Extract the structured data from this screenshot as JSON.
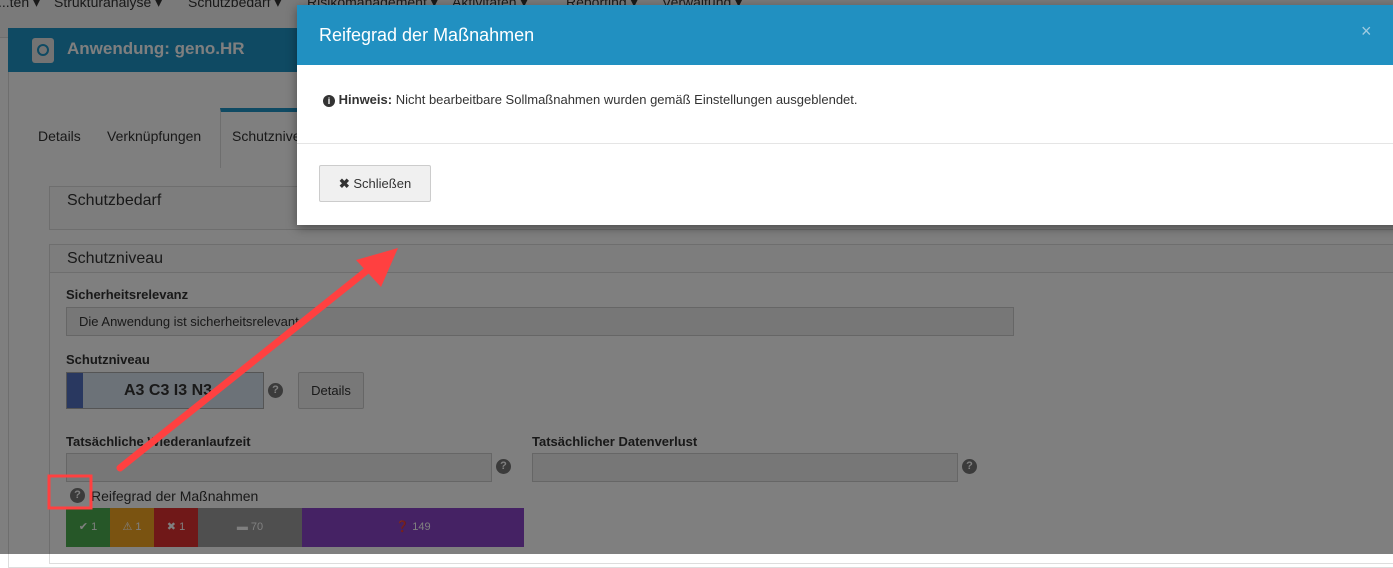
{
  "topnav": {
    "items": [
      "...ten ▾",
      "Strukturanalyse ▾",
      "Schutzbedarf ▾",
      "Risikomanagement ▾",
      "Aktivitäten ▾",
      "Reporting ▾",
      "Verwaltung ▾"
    ]
  },
  "card": {
    "title": "Anwendung: geno.HR",
    "tabs": [
      "Details",
      "Verknüpfungen",
      "Schutzniveau"
    ]
  },
  "schutzbedarf": {
    "title": "Schutzbedarf"
  },
  "schutzniveau": {
    "title": "Schutzniveau",
    "sicherheitsrelevanz_label": "Sicherheitsrelevanz",
    "sicherheitsrelevanz_value": "Die Anwendung ist sicherheitsrelevant",
    "schutzniveau_label": "Schutzniveau",
    "schutzniveau_value": "A3 C3 I3 N3",
    "details_button": "Details",
    "wiederanlaufzeit_label": "Tatsächliche Wiederanlaufzeit",
    "datenverlust_label": "Tatsächlicher Datenverlust",
    "reifegrad_label": "Reifegrad der Maßnahmen",
    "reifegrad": [
      {
        "icon": "check-circle-icon",
        "count": "1",
        "color": "#4caf50"
      },
      {
        "icon": "warning-icon",
        "count": "1",
        "color": "#f5a623"
      },
      {
        "icon": "x-circle-icon",
        "count": "1",
        "color": "#e03030"
      },
      {
        "icon": "minus-square-icon",
        "count": "70",
        "color": "#9e9e9e"
      },
      {
        "icon": "question-circle-icon",
        "count": "149",
        "color": "#8a44c8"
      }
    ]
  },
  "modal": {
    "title": "Reifegrad der Maßnahmen",
    "close_icon": "×",
    "hint_label": "Hinweis:",
    "hint_text": "Nicht bearbeitbare Sollmaßnahmen wurden gemäß Einstellungen ausgeblendet.",
    "close_button": "Schließen"
  },
  "annotation_color": "#ff4040"
}
